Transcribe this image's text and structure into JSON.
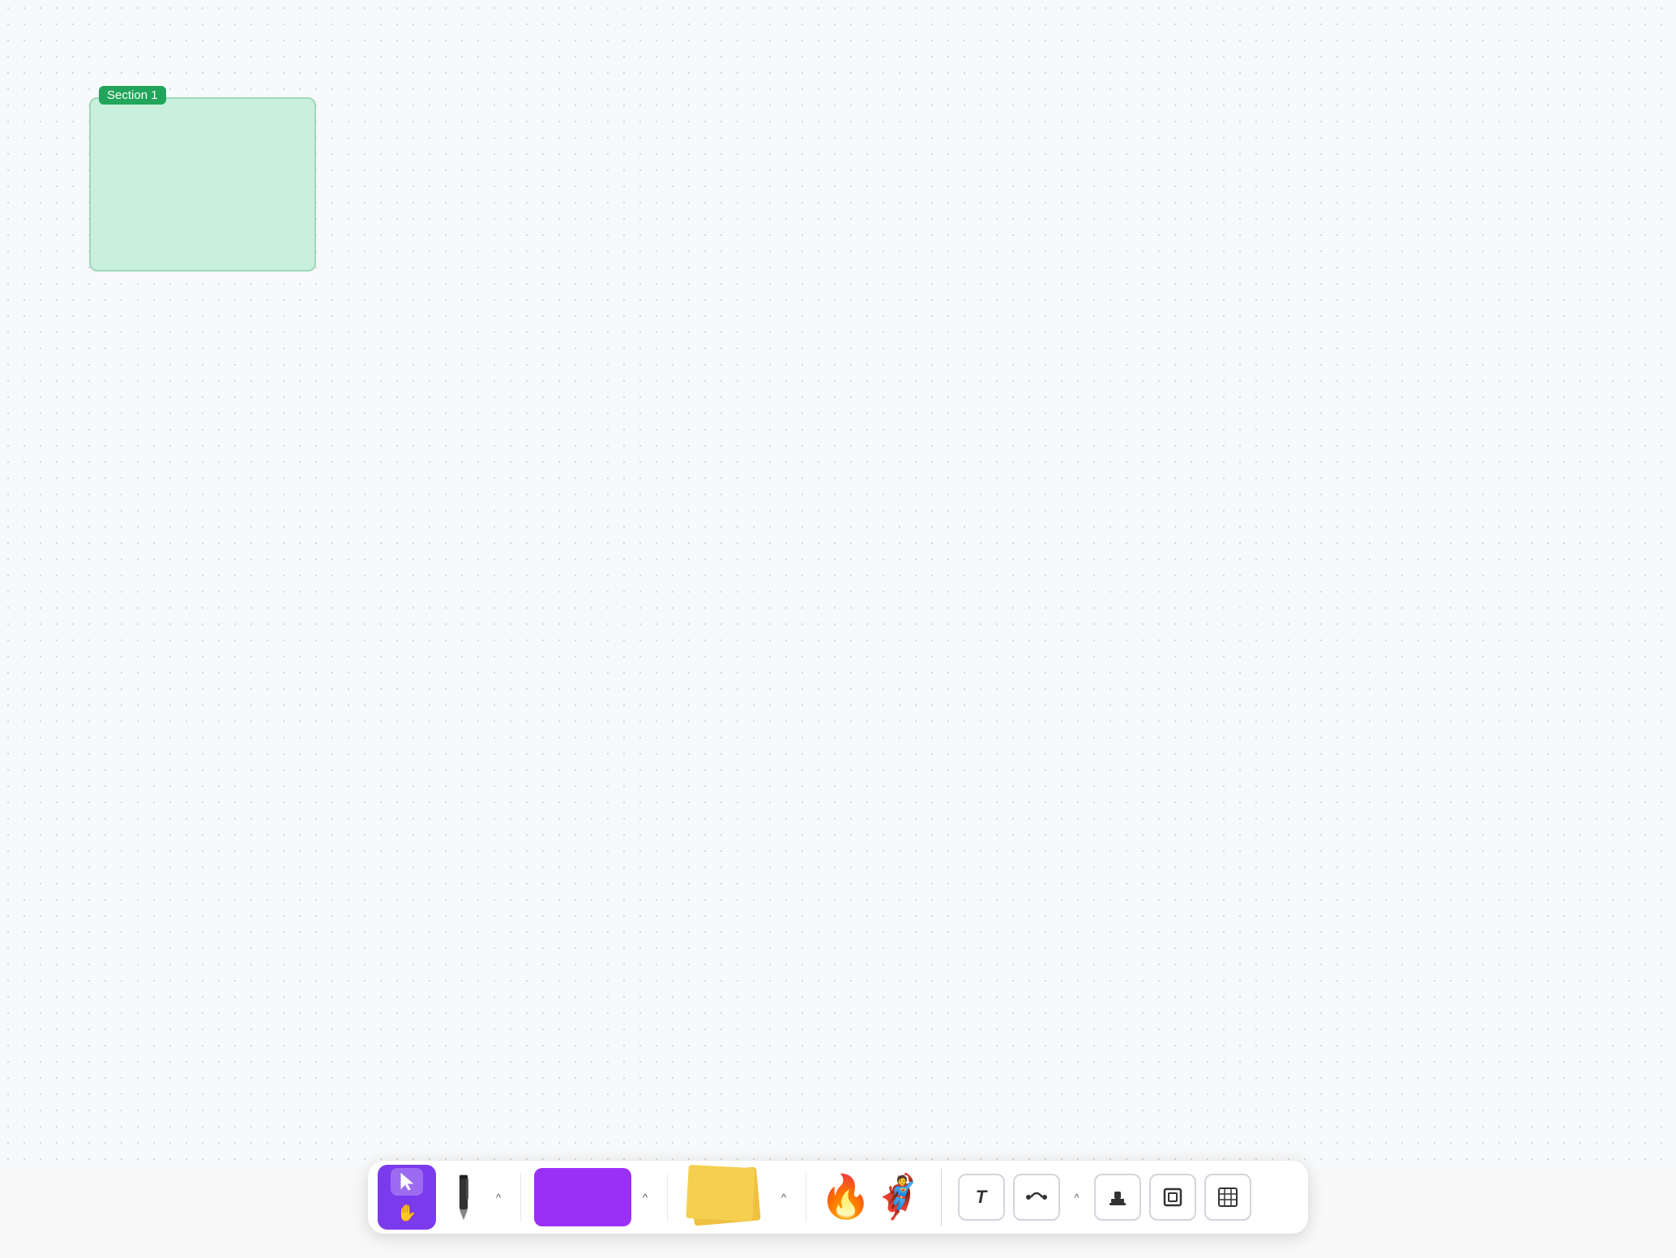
{
  "canvas": {
    "background": "#f8f9fa"
  },
  "section": {
    "label": "Section 1",
    "background_color": "#c8f0dc",
    "border_color": "#a0d8b8",
    "label_bg": "#22a55b"
  },
  "toolbar": {
    "tools": {
      "select_label": "Select",
      "hand_label": "Hand",
      "pen_label": "Pen",
      "color_label": "Color",
      "sticky_label": "Sticky Notes",
      "mascot_label": "Mascot",
      "text_label": "T",
      "connector_label": "Connector",
      "stamp_label": "Stamp",
      "frame_label": "Frame",
      "table_label": "Table"
    },
    "chevron_up": "^",
    "colors": {
      "purple": "#9b30f5"
    }
  }
}
